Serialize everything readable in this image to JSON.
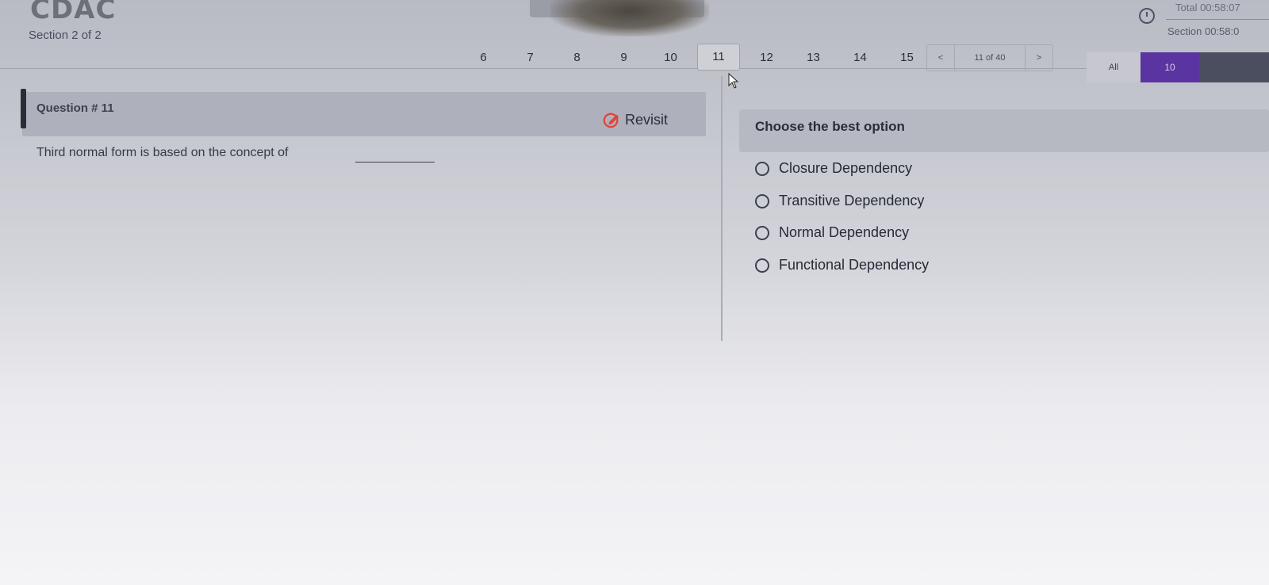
{
  "header": {
    "logo_text": "CDAC",
    "section_label": "Section 2 of 2",
    "timer": {
      "icon": "clock-icon",
      "total": "Total 00:58:07",
      "section": "Section 00:58:0"
    }
  },
  "pagination": {
    "pages": [
      "6",
      "7",
      "8",
      "9",
      "10",
      "11",
      "12",
      "13",
      "14",
      "15"
    ],
    "active_page": "11",
    "prev_label": "<",
    "position_label": "11 of 40",
    "next_label": ">",
    "filter_all_label": "All",
    "filter_count": "10",
    "filter_active_color": "#5a34a0"
  },
  "question": {
    "title": "Question # 11",
    "revisit_label": "Revisit",
    "revisit_icon": "edit-icon",
    "revisit_color": "#e0443a",
    "text": "Third normal form is based on the concept of"
  },
  "answers": {
    "title": "Choose the best option",
    "options": [
      "Closure Dependency",
      "Transitive Dependency",
      "Normal Dependency",
      "Functional Dependency"
    ]
  }
}
